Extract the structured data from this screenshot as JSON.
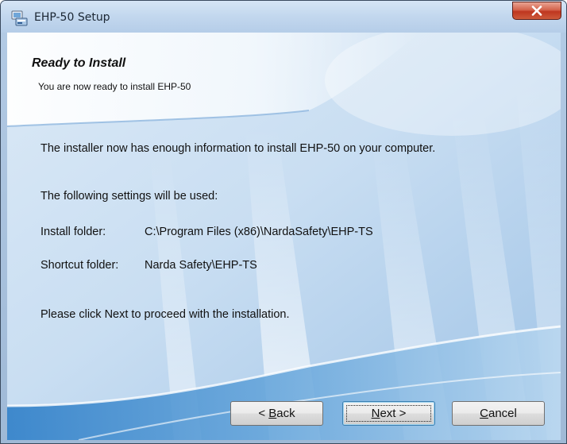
{
  "window": {
    "title": "EHP-50 Setup"
  },
  "header": {
    "title": "Ready to Install",
    "subtitle": "You are now ready to install EHP-50"
  },
  "content": {
    "intro": "The installer now has enough information to install EHP-50 on your computer.",
    "settings_heading": "The following settings will be used:",
    "install_folder_label": "Install folder:",
    "install_folder_value": "C:\\Program Files (x86)\\NardaSafety\\EHP-TS",
    "shortcut_folder_label": "Shortcut folder:",
    "shortcut_folder_value": "Narda Safety\\EHP-TS",
    "proceed": "Please click Next to proceed with the installation."
  },
  "buttons": {
    "back": {
      "prefix": "< ",
      "mnemonic": "B",
      "rest": "ack"
    },
    "next": {
      "mnemonic": "N",
      "rest": "ext >"
    },
    "cancel": {
      "mnemonic": "C",
      "rest": "ancel"
    }
  },
  "icons": {
    "app": "setup-app-icon",
    "close": "close-icon"
  },
  "colors": {
    "frame": "#b2cae4",
    "close_button": "#c8472c",
    "default_button_border": "#3c7fb1"
  }
}
